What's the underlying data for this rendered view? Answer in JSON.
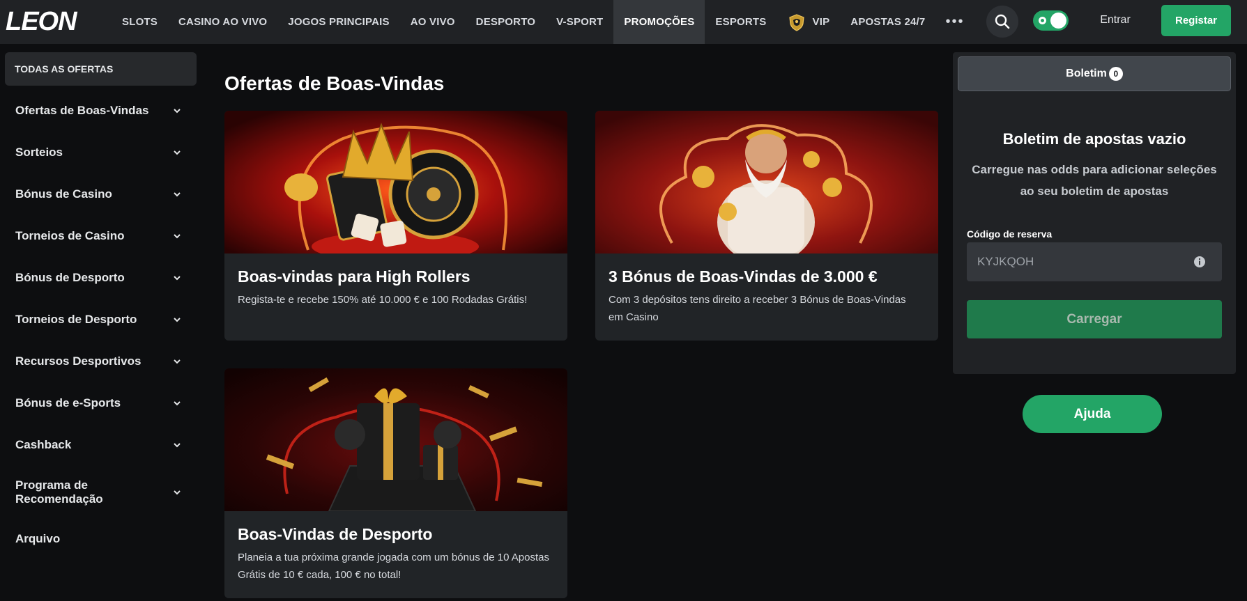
{
  "brand": {
    "logo_text": "LEON"
  },
  "nav": {
    "items": [
      {
        "label": "SLOTS"
      },
      {
        "label": "CASINO AO VIVO"
      },
      {
        "label": "JOGOS PRINCIPAIS"
      },
      {
        "label": "AO VIVO"
      },
      {
        "label": "DESPORTO"
      },
      {
        "label": "V-SPORT"
      },
      {
        "label": "PROMOÇÕES",
        "active": true
      },
      {
        "label": "ESPORTS"
      },
      {
        "label": "VIP",
        "icon": "lion-shield-icon"
      },
      {
        "label": "APOSTAS 24/7"
      }
    ],
    "more_icon": "more-horizontal-icon"
  },
  "header_actions": {
    "search_icon": "search-icon",
    "toggle_state": "on",
    "login_label": "Entrar",
    "register_label": "Registar"
  },
  "sidebar": {
    "header": "TODAS AS OFERTAS",
    "items": [
      {
        "label": "Ofertas de Boas-Vindas",
        "chevron": true
      },
      {
        "label": "Sorteios",
        "chevron": true
      },
      {
        "label": "Bónus de Casino",
        "chevron": true
      },
      {
        "label": "Torneios de Casino",
        "chevron": true
      },
      {
        "label": "Bónus de Desporto",
        "chevron": true
      },
      {
        "label": "Torneios de Desporto",
        "chevron": true
      },
      {
        "label": "Recursos Desportivos",
        "chevron": true
      },
      {
        "label": "Bónus de e-Sports",
        "chevron": true
      },
      {
        "label": "Cashback",
        "chevron": true
      },
      {
        "label": "Programa de Recomendação",
        "chevron": true
      },
      {
        "label": "Arquivo",
        "chevron": false
      }
    ]
  },
  "main": {
    "title": "Ofertas de Boas-Vindas",
    "offers": [
      {
        "title": "Boas-vindas para High Rollers",
        "description": "Regista-te e recebe 150% até 10.000 € e 100 Rodadas Grátis!",
        "image": "crown-roulette-dice-banner"
      },
      {
        "title": "3 Bónus de Boas-Vindas de 3.000 €",
        "description": "Com 3 depósitos tens direito a receber 3 Bónus de Boas-Vindas em Casino",
        "image": "zeus-gold-coins-banner"
      },
      {
        "title": "Boas-Vindas de Desporto",
        "description": "Planeia a tua próxima grande jogada com um bónus de 10 Apostas Grátis de 10 € cada, 100 € no total!",
        "image": "gift-boxes-confetti-banner"
      }
    ]
  },
  "betslip": {
    "tab_label": "Boletim",
    "count": "0",
    "empty_title": "Boletim de apostas vazio",
    "empty_description": "Carregue nas odds para adicionar seleções ao seu boletim de apostas",
    "code_label": "Código de reserva",
    "code_value": "KYJKQOH",
    "load_label": "Carregar",
    "info_icon": "info-icon"
  },
  "help": {
    "label": "Ajuda"
  },
  "colors": {
    "accent_green": "#23a566",
    "background": "#0d0e10",
    "topbar": "#202225",
    "card": "#212427"
  }
}
